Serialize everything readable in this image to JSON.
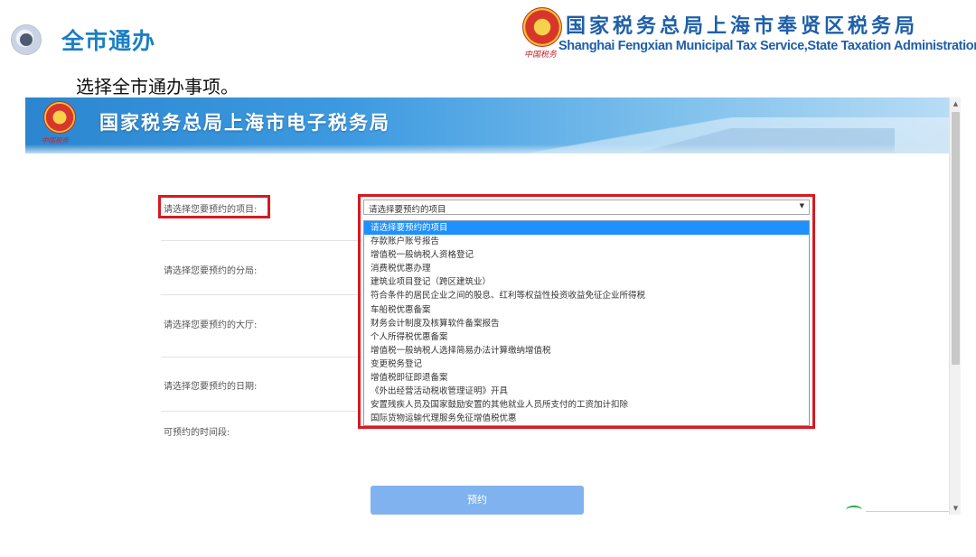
{
  "slide": {
    "title": "全市通办",
    "subtitle": "选择全市通办事项。",
    "org_name_cn": "国家税务总局上海市奉贤区税务局",
    "org_name_en": "Shanghai Fengxian Municipal Tax Service,State Taxation Administration",
    "logo_caption": "中国税务"
  },
  "site": {
    "banner_title": "国家税务总局上海市电子税务局",
    "logo_caption": "中国税务"
  },
  "form": {
    "labels": {
      "project": "请选择您要预约的项目:",
      "branch": "请选择您要预约的分局:",
      "hall": "请选择您要预约的大厅:",
      "date": "请选择您要预约的日期:",
      "time_slot": "可预约的时间段:"
    },
    "project_select": {
      "selected_value": "请选择要预约的项目",
      "options": [
        "请选择要预约的项目",
        "存款账户账号报告",
        "增值税一般纳税人资格登记",
        "消费税优惠办理",
        "建筑业项目登记（跨区建筑业）",
        "符合条件的居民企业之间的股息、红利等权益性投资收益免征企业所得税",
        "车船税优惠备案",
        "财务会计制度及核算软件备案报告",
        "个人所得税优惠备案",
        "增值税一般纳税人选择简易办法计算缴纳增值税",
        "变更税务登记",
        "增值税即征即退备案",
        "《外出经营活动税收管理证明》开具",
        "安置残疾人员及国家鼓励安置的其他就业人员所支付的工资加计扣除",
        "国际货物运输代理服务免征增值税优惠"
      ],
      "highlighted_index": 0
    },
    "submit_label": "预约"
  },
  "colors": {
    "slide_title": "#1b7fc4",
    "org_name": "#1e5fa8",
    "highlight_border": "#d71920",
    "selected_option_bg": "#1e90ff",
    "submit_bg": "#7fb2ee"
  },
  "icons": {
    "slide_bullet": "circle-bullet-icon",
    "logo": "tax-emblem-icon",
    "dropdown": "triangle-down-icon"
  }
}
